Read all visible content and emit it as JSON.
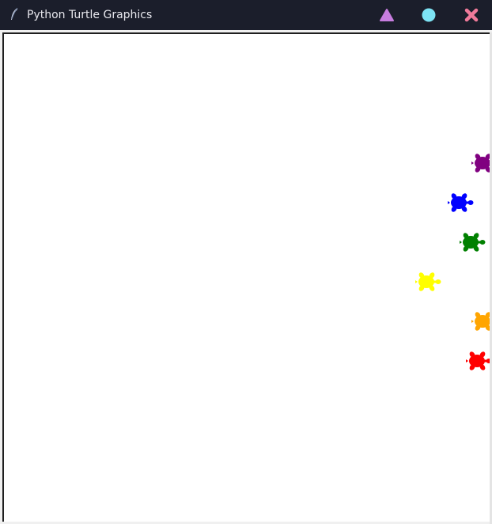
{
  "window": {
    "title": "Python Turtle Graphics",
    "icons": {
      "app": "feather-icon",
      "minimize": "triangle-icon",
      "maximize": "circle-icon",
      "close": "x-icon"
    },
    "colors": {
      "titlebar": "#1b1e2b",
      "minimize": "#c77ddf",
      "maximize": "#7de3f4",
      "close": "#f07a9a"
    }
  },
  "canvas": {
    "background": "#ffffff",
    "turtles": [
      {
        "name": "turtle-purple",
        "color": "#800080"
      },
      {
        "name": "turtle-blue",
        "color": "#0000ff"
      },
      {
        "name": "turtle-green",
        "color": "#008000"
      },
      {
        "name": "turtle-yellow",
        "color": "#ffff00"
      },
      {
        "name": "turtle-orange",
        "color": "#ffa500"
      },
      {
        "name": "turtle-red",
        "color": "#ff0000"
      }
    ]
  }
}
